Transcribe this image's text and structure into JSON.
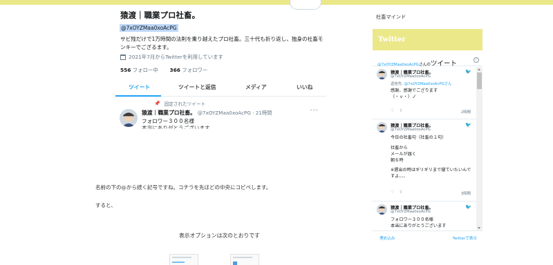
{
  "profile": {
    "display_name": "猿渡｜職業プロ社畜。",
    "handle": "@7xOYZMaa0xoAcPG",
    "bio": "サビ残だけで1万時間の法則を乗り越えたプロ社畜。三十代も折り返し、独身の社畜モンキーでござるます。",
    "joined": "2021年7月からTwitterを利用しています",
    "following_count": "556",
    "following_label": "フォロー中",
    "followers_count": "366",
    "followers_label": "フォロワー",
    "tabs": [
      {
        "label": "ツイート",
        "active": true
      },
      {
        "label": "ツイートと返信"
      },
      {
        "label": "メディア"
      },
      {
        "label": "いいね"
      }
    ],
    "pinned_label": "固定されたツイート",
    "pinned_tweet": {
      "name": "猿渡｜職業プロ社畜。",
      "meta": "@7xOYZMaa0xoAcPG · 21時間",
      "line1": "フォロワー３００名様",
      "line2": "本当にありがとうございます"
    }
  },
  "article": {
    "para1": "名前の下の@から続く記号ですね。コチラを先ほどの中央にコピペします。",
    "para2": "すると、",
    "para3": "表示オプションは次のとおりです"
  },
  "sidebar": {
    "text": "社畜マインド",
    "widget_title": "Twitter",
    "accent_color": "#ebe88a",
    "timeline": {
      "header_handle": "@7xOYZMaa0xoAcPG",
      "header_suffix": "さんの",
      "header_title": "ツイート",
      "tweets": [
        {
          "name": "猿渡｜職業プロ社畜。",
          "handle": "@7xOYZMaa0xoAcPG",
          "reply_prefix": "返信先: ",
          "reply_to": "@7xOYZMaa0xoAcPGさん",
          "lines": [
            "感謝、感謝でござります",
            "（・ｖ・）ノ"
          ],
          "time": "2時間"
        },
        {
          "name": "猿渡｜職業プロ社畜。",
          "handle": "@7xOYZMaa0xoAcPG",
          "lines": [
            "今日の社畜句（社畜の１句）",
            "",
            "社畜から",
            "メールが届く",
            "朝６時",
            "",
            "※遅出の時はギリギリまで寝ていたいんですよ、、、"
          ],
          "time": "3時間"
        },
        {
          "name": "猿渡｜職業プロ社畜。",
          "handle": "@7xOYZMaa0xoAcPG",
          "lines": [
            "フォロワー３００名様",
            "本当にありがとうございます"
          ],
          "time": ""
        }
      ],
      "embed_label": "埋め込み",
      "view_label": "Twitterで表示"
    }
  }
}
